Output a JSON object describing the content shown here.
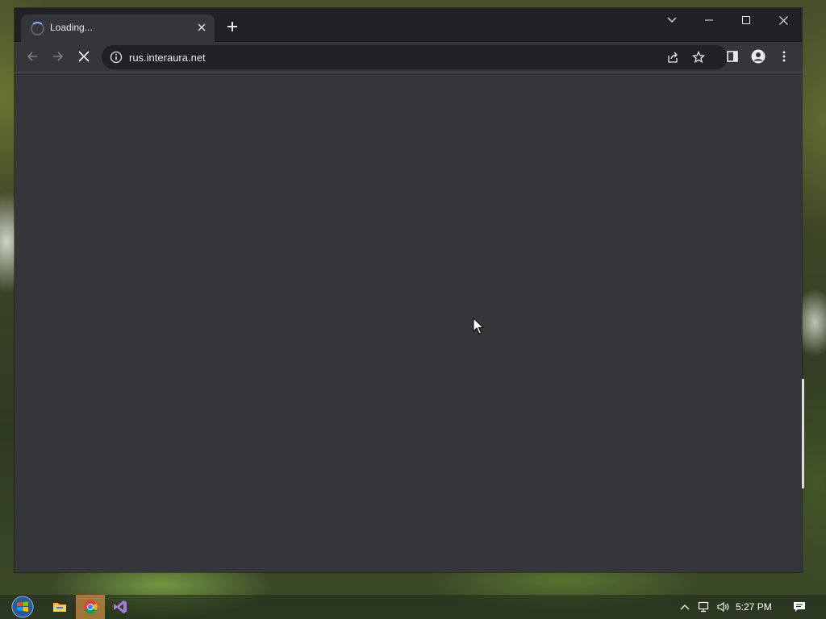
{
  "browser": {
    "tab": {
      "title": "Loading..."
    },
    "address_bar": {
      "url": "rus.interaura.net"
    }
  },
  "taskbar": {
    "clock": "5:27 PM"
  }
}
